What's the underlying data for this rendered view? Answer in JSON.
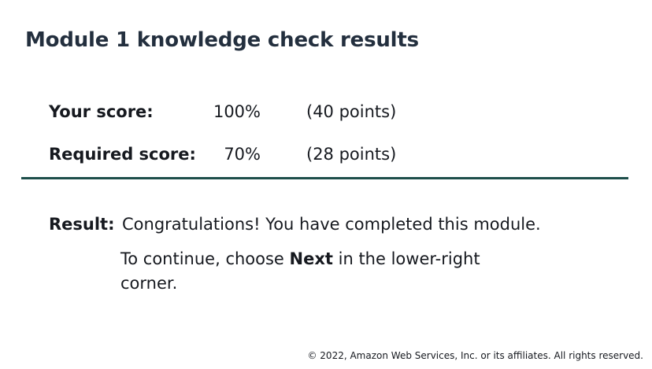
{
  "title": "Module 1 knowledge check results",
  "scores": {
    "your": {
      "label": "Your score:",
      "percent": "100%",
      "points": "(40 points)"
    },
    "required": {
      "label": "Required score:",
      "percent": "70%",
      "points": "(28 points)"
    }
  },
  "result": {
    "label": "Result:",
    "message": "Congratulations! You have completed this module.",
    "continue_prefix": "To continue, choose ",
    "continue_emphasis": "Next",
    "continue_suffix": " in the lower-right corner."
  },
  "footer": "© 2022, Amazon Web Services, Inc. or its affiliates. All rights reserved.",
  "colors": {
    "title": "#232f3e",
    "divider": "#1d4e4a",
    "text": "#16191f"
  }
}
